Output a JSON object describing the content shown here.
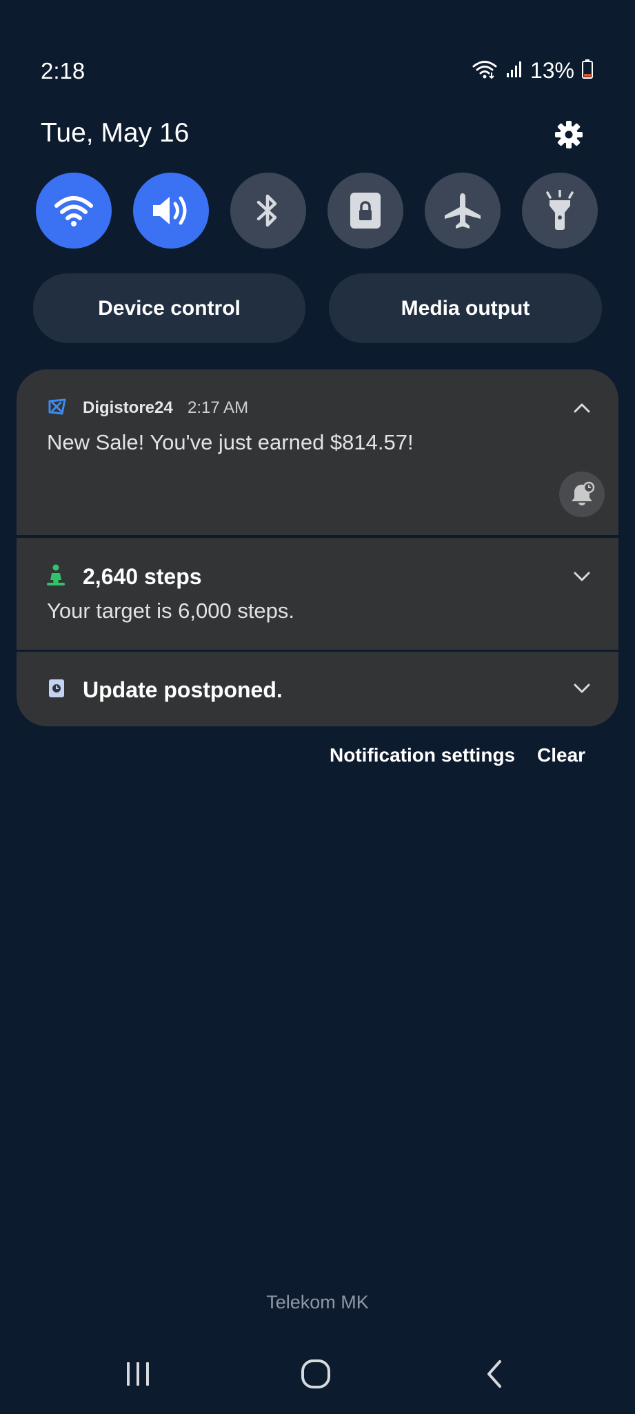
{
  "status_bar": {
    "time": "2:18",
    "battery": "13%",
    "icons": [
      "wifi-status-icon",
      "signal-icon",
      "battery-icon"
    ]
  },
  "header": {
    "date": "Tue, May 16",
    "settings_icon": "gear-icon"
  },
  "quick_settings": {
    "tiles": [
      {
        "name": "wifi",
        "icon": "wifi-icon",
        "active": true
      },
      {
        "name": "sound",
        "icon": "volume-icon",
        "active": true
      },
      {
        "name": "bluetooth",
        "icon": "bluetooth-icon",
        "active": false
      },
      {
        "name": "secure-folder",
        "icon": "lock-icon",
        "active": false
      },
      {
        "name": "airplane-mode",
        "icon": "airplane-icon",
        "active": false
      },
      {
        "name": "flashlight",
        "icon": "flashlight-icon",
        "active": false
      }
    ],
    "device_control_label": "Device control",
    "media_output_label": "Media output"
  },
  "notifications": [
    {
      "app": "Digistore24",
      "time": "2:17 AM",
      "body": "New Sale! You've just earned $814.57!",
      "icon": "digistore-icon",
      "expanded": true
    },
    {
      "title": "2,640 steps",
      "body": "Your target is 6,000 steps.",
      "icon": "walking-icon",
      "expanded": false
    },
    {
      "title": "Update postponed.",
      "icon": "update-clock-icon",
      "expanded": false
    }
  ],
  "footer": {
    "notification_settings_label": "Notification settings",
    "clear_label": "Clear"
  },
  "carrier": "Telekom MK",
  "colors": {
    "background": "#0d1b2e",
    "accent": "#3b71f3",
    "tile_inactive": "#3c4656",
    "card": "#333436",
    "steps_green": "#2fc46a"
  }
}
